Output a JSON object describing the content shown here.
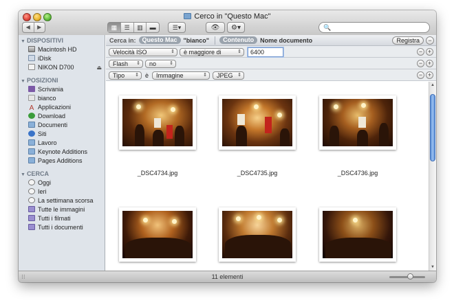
{
  "window": {
    "title": "Cerco in \"Questo Mac\""
  },
  "toolbar": {
    "back_glyph": "◀",
    "forward_glyph": "▶",
    "view_icons": [
      "icon-view-icon",
      "list-view-icon",
      "column-view-icon",
      "coverflow-view-icon"
    ],
    "view_glyphs": [
      "▦",
      "☰",
      "▥",
      "▬"
    ],
    "arrange_glyph": "☰▾",
    "quicklook_glyph": "👁",
    "action_glyph": "⚙▾",
    "search_placeholder": "",
    "search_glyph": "🔍"
  },
  "sidebar": {
    "sections": {
      "devices": {
        "title": "DISPOSITIVI",
        "items": [
          "Macintosh HD",
          "iDisk",
          "NIKON D700"
        ]
      },
      "places": {
        "title": "POSIZIONI",
        "items": [
          "Scrivania",
          "bianco",
          "Applicazioni",
          "Download",
          "Documenti",
          "Siti",
          "Lavoro",
          "Keynote Additions",
          "Pages Additions"
        ]
      },
      "search": {
        "title": "CERCA",
        "items": [
          "Oggi",
          "Ieri",
          "La settimana scorsa",
          "Tutte le immagini",
          "Tutti i filmati",
          "Tutti i documenti"
        ]
      }
    },
    "eject_glyph": "⏏"
  },
  "searchbar": {
    "label": "Cerca in:",
    "scope_selected": "Questo Mac",
    "scope_other": "\"bianco\"",
    "content_selected": "Contenuto",
    "content_other": "Nome documento",
    "save_label": "Registra",
    "remove_glyph": "−"
  },
  "criteria": [
    {
      "attr": "Velocità ISO",
      "op": "è maggiore di",
      "value": "6400"
    },
    {
      "attr": "Flash",
      "op": "no"
    },
    {
      "attr": "Tipo",
      "connector": "è",
      "op": "Immagine",
      "value": "JPEG"
    }
  ],
  "criteria_buttons": {
    "minus": "−",
    "plus": "+"
  },
  "files": [
    {
      "name": "_DSC4734.jpg"
    },
    {
      "name": "_DSC4735.jpg"
    },
    {
      "name": "_DSC4736.jpg"
    },
    {
      "name": ""
    },
    {
      "name": ""
    },
    {
      "name": ""
    }
  ],
  "status": {
    "text": "11 elementi",
    "zoom_level": 0.6
  },
  "colors": {
    "accent": "#3b74c8",
    "sidebar_bg": "#dfe4ea"
  }
}
